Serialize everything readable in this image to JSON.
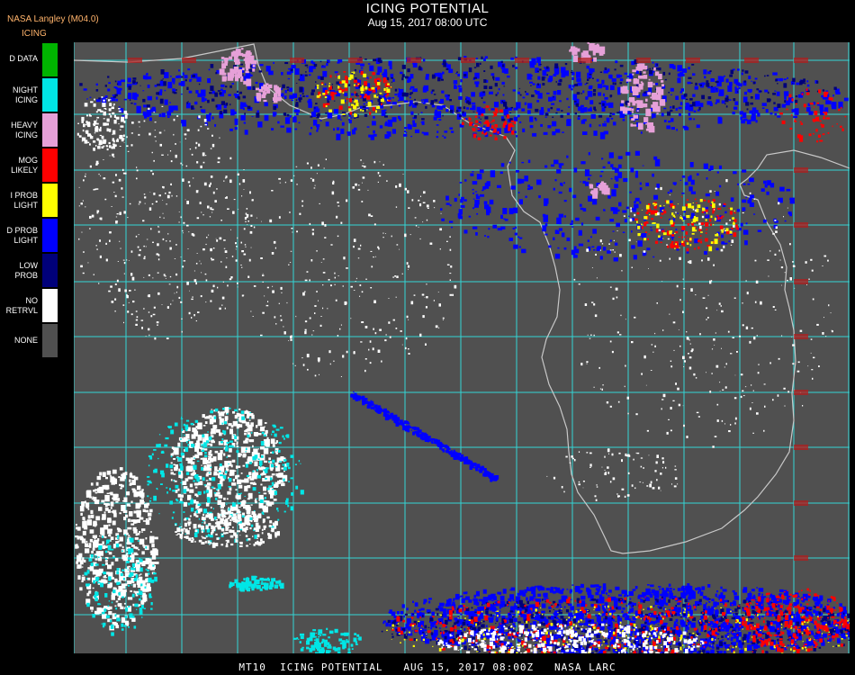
{
  "header": {
    "source": "NASA Langley (M04.0)",
    "product": "ICING",
    "title": "ICING POTENTIAL",
    "datetime": "Aug 15, 2017 08:00 UTC"
  },
  "legend": [
    {
      "label": "D DATA",
      "color": "#00b400"
    },
    {
      "label": "NIGHT\nICING",
      "color": "#00e6e6"
    },
    {
      "label": "HEAVY\nICING",
      "color": "#e6a0d8"
    },
    {
      "label": "MOG\nLIKELY",
      "color": "#ff0000"
    },
    {
      "label": "I PROB\nLIGHT",
      "color": "#ffff00"
    },
    {
      "label": "D PROB\nLIGHT",
      "color": "#0000ff"
    },
    {
      "label": "LOW\nPROB",
      "color": "#00007a"
    },
    {
      "label": "NO\nRETRVL",
      "color": "#ffffff"
    },
    {
      "label": "NONE",
      "color": "#505050"
    }
  ],
  "map": {
    "background": "#505050",
    "grid_color": "#33d6d6",
    "coast_color": "#c8c8c8",
    "label_color": "#b01e1e"
  },
  "footer": {
    "text": "MT10  ICING POTENTIAL   AUG 15, 2017 08:00Z   NASA LARC"
  }
}
